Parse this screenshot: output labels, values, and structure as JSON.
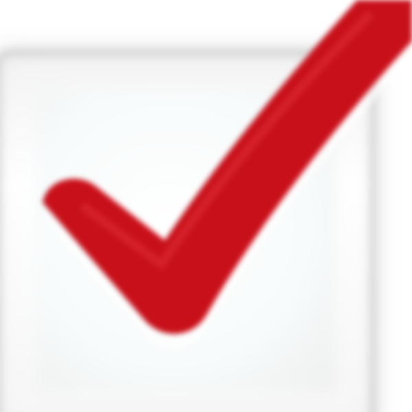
{
  "control": {
    "type": "checkbox",
    "checked": true,
    "check_icon": "checkmark-icon"
  },
  "colors": {
    "check": "#c8101a",
    "check_dark": "#a80a12",
    "box_fill": "#f7f7f7",
    "box_border": "#cfcfcf"
  }
}
